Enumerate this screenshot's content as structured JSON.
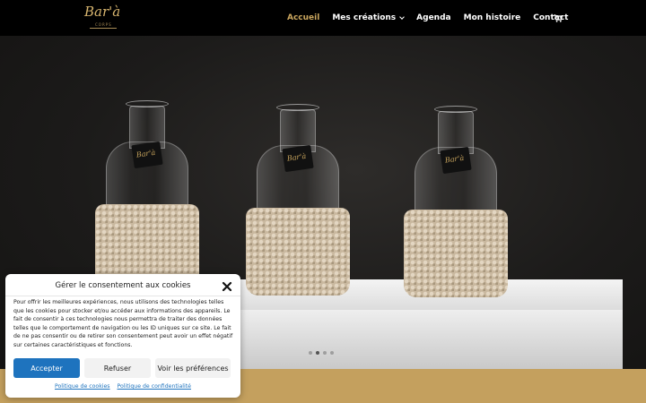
{
  "header": {
    "logo": {
      "main": "Bar'à",
      "sub": "CORPS"
    },
    "nav": [
      {
        "label": "Accueil",
        "active": true
      },
      {
        "label": "Mes créations",
        "has_dropdown": true
      },
      {
        "label": "Agenda"
      },
      {
        "label": "Mon histoire"
      },
      {
        "label": "Contact"
      }
    ],
    "cart_icon": "shopping-cart-icon"
  },
  "hero": {
    "tag_text": "Bar'à",
    "slider_dots": 4,
    "active_dot": 2
  },
  "consent": {
    "title": "Gérer le consentement aux cookies",
    "body": "Pour offrir les meilleures expériences, nous utilisons des technologies telles que les cookies pour stocker et/ou accéder aux informations des appareils. Le fait de consentir à ces technologies nous permettra de traiter des données telles que le comportement de navigation ou les ID uniques sur ce site. Le fait de ne pas consentir ou de retirer son consentement peut avoir un effet négatif sur certaines caractéristiques et fonctions.",
    "buttons": {
      "accept": "Accepter",
      "refuse": "Refuser",
      "preferences": "Voir les préférences"
    },
    "links": {
      "cookie_policy": "Politique de cookies",
      "privacy_policy": "Politique de confidentialité"
    }
  },
  "colors": {
    "accent": "#caa65e",
    "button_blue": "#1e73be",
    "footer_band": "#c4a05e"
  }
}
